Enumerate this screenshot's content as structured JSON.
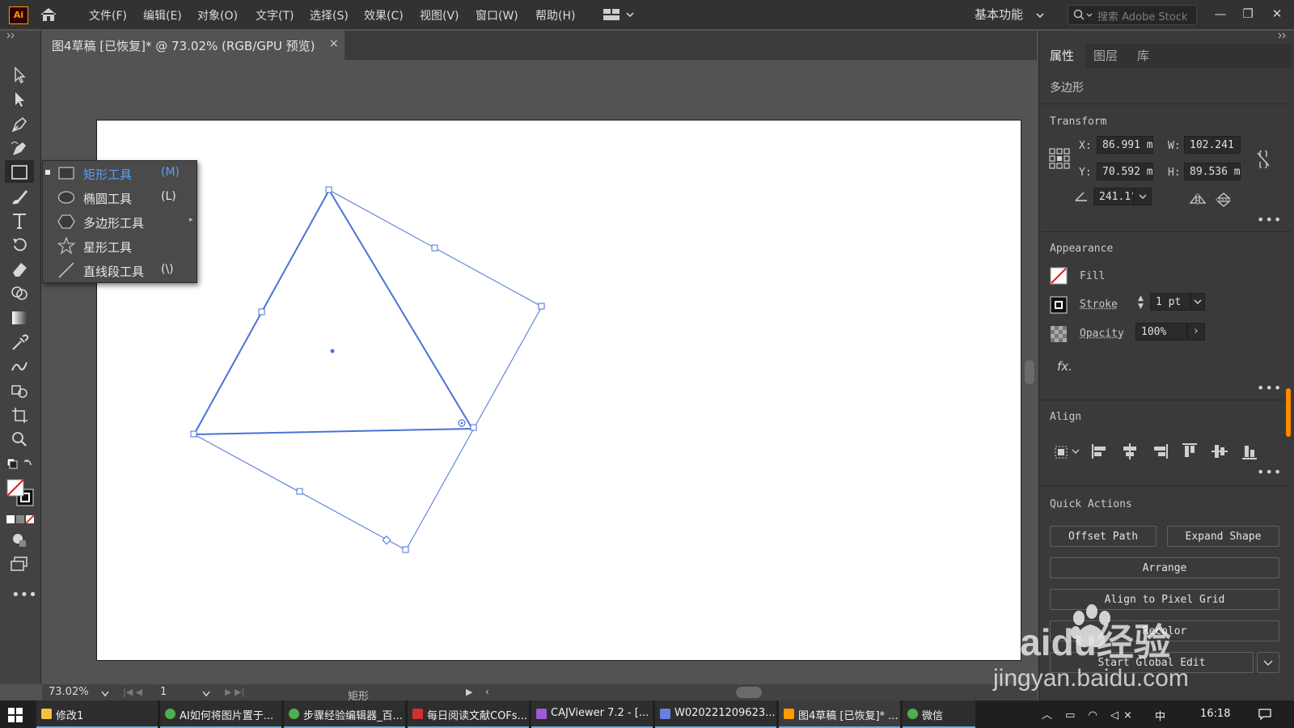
{
  "app": {
    "logo": "Ai",
    "menus": [
      "文件(F)",
      "编辑(E)",
      "对象(O)",
      "文字(T)",
      "选择(S)",
      "效果(C)",
      "视图(V)",
      "窗口(W)",
      "帮助(H)"
    ],
    "workspace": "基本功能",
    "search_placeholder": "搜索 Adobe Stock"
  },
  "document": {
    "tab_title": "图4草稿 [已恢复]* @ 73.02% (RGB/GPU 预览)",
    "close": "×"
  },
  "tool_flyout": {
    "items": [
      {
        "label": "矩形工具",
        "key": "(M)",
        "icon": "rectangle-icon",
        "selected": true
      },
      {
        "label": "椭圆工具",
        "key": "(L)",
        "icon": "ellipse-icon",
        "selected": false
      },
      {
        "label": "多边形工具",
        "key": "",
        "icon": "polygon-icon",
        "selected": false
      },
      {
        "label": "星形工具",
        "key": "",
        "icon": "star-icon",
        "selected": false
      },
      {
        "label": "直线段工具",
        "key": "(\\)",
        "icon": "line-icon",
        "selected": false
      }
    ]
  },
  "status": {
    "zoom": "73.02%",
    "page": "1",
    "tool_name": "矩形"
  },
  "panel": {
    "tabs": [
      "属性",
      "图层",
      "库"
    ],
    "object_type": "多边形",
    "transform": {
      "title": "Transform",
      "x_label": "X:",
      "x": "86.991 m",
      "y_label": "Y:",
      "y": "70.592 m",
      "w_label": "W:",
      "w": "102.241",
      "h_label": "H:",
      "h": "89.536 m",
      "angle": "241.1°"
    },
    "appearance": {
      "title": "Appearance",
      "fill_label": "Fill",
      "stroke_label": "Stroke",
      "stroke_value": "1 pt",
      "opacity_label": "Opacity",
      "opacity_value": "100%",
      "fx": "fx."
    },
    "align": {
      "title": "Align"
    },
    "quick_actions": {
      "title": "Quick Actions",
      "offset_path": "Offset Path",
      "expand_shape": "Expand Shape",
      "arrange": "Arrange",
      "align_pixel": "Align to Pixel Grid",
      "recolor": "Recolor",
      "global_edit": "Start Global Edit"
    }
  },
  "taskbar": {
    "items": [
      {
        "label": "修改1",
        "color": "#f0c040"
      },
      {
        "label": "AI如何将图片置于...",
        "color": "#4caf50"
      },
      {
        "label": "步骤经验编辑器_百...",
        "color": "#4caf50"
      },
      {
        "label": "每日阅读文献COFs...",
        "color": "#d03030"
      },
      {
        "label": "CAJViewer 7.2 - [...",
        "color": "#9c5cd6"
      },
      {
        "label": "W020221209623...",
        "color": "#6a7ee0"
      },
      {
        "label": "图4草稿 [已恢复]* ...",
        "color": "#ff9a00"
      },
      {
        "label": "微信",
        "color": "#4caf50"
      }
    ],
    "time": "16:18",
    "ime": "中"
  },
  "watermark": {
    "brand": "Baidu经验",
    "url": "jingyan.baidu.com"
  },
  "colors": {
    "selection": "#4a72d8",
    "highlight": "#5a9ef5"
  }
}
